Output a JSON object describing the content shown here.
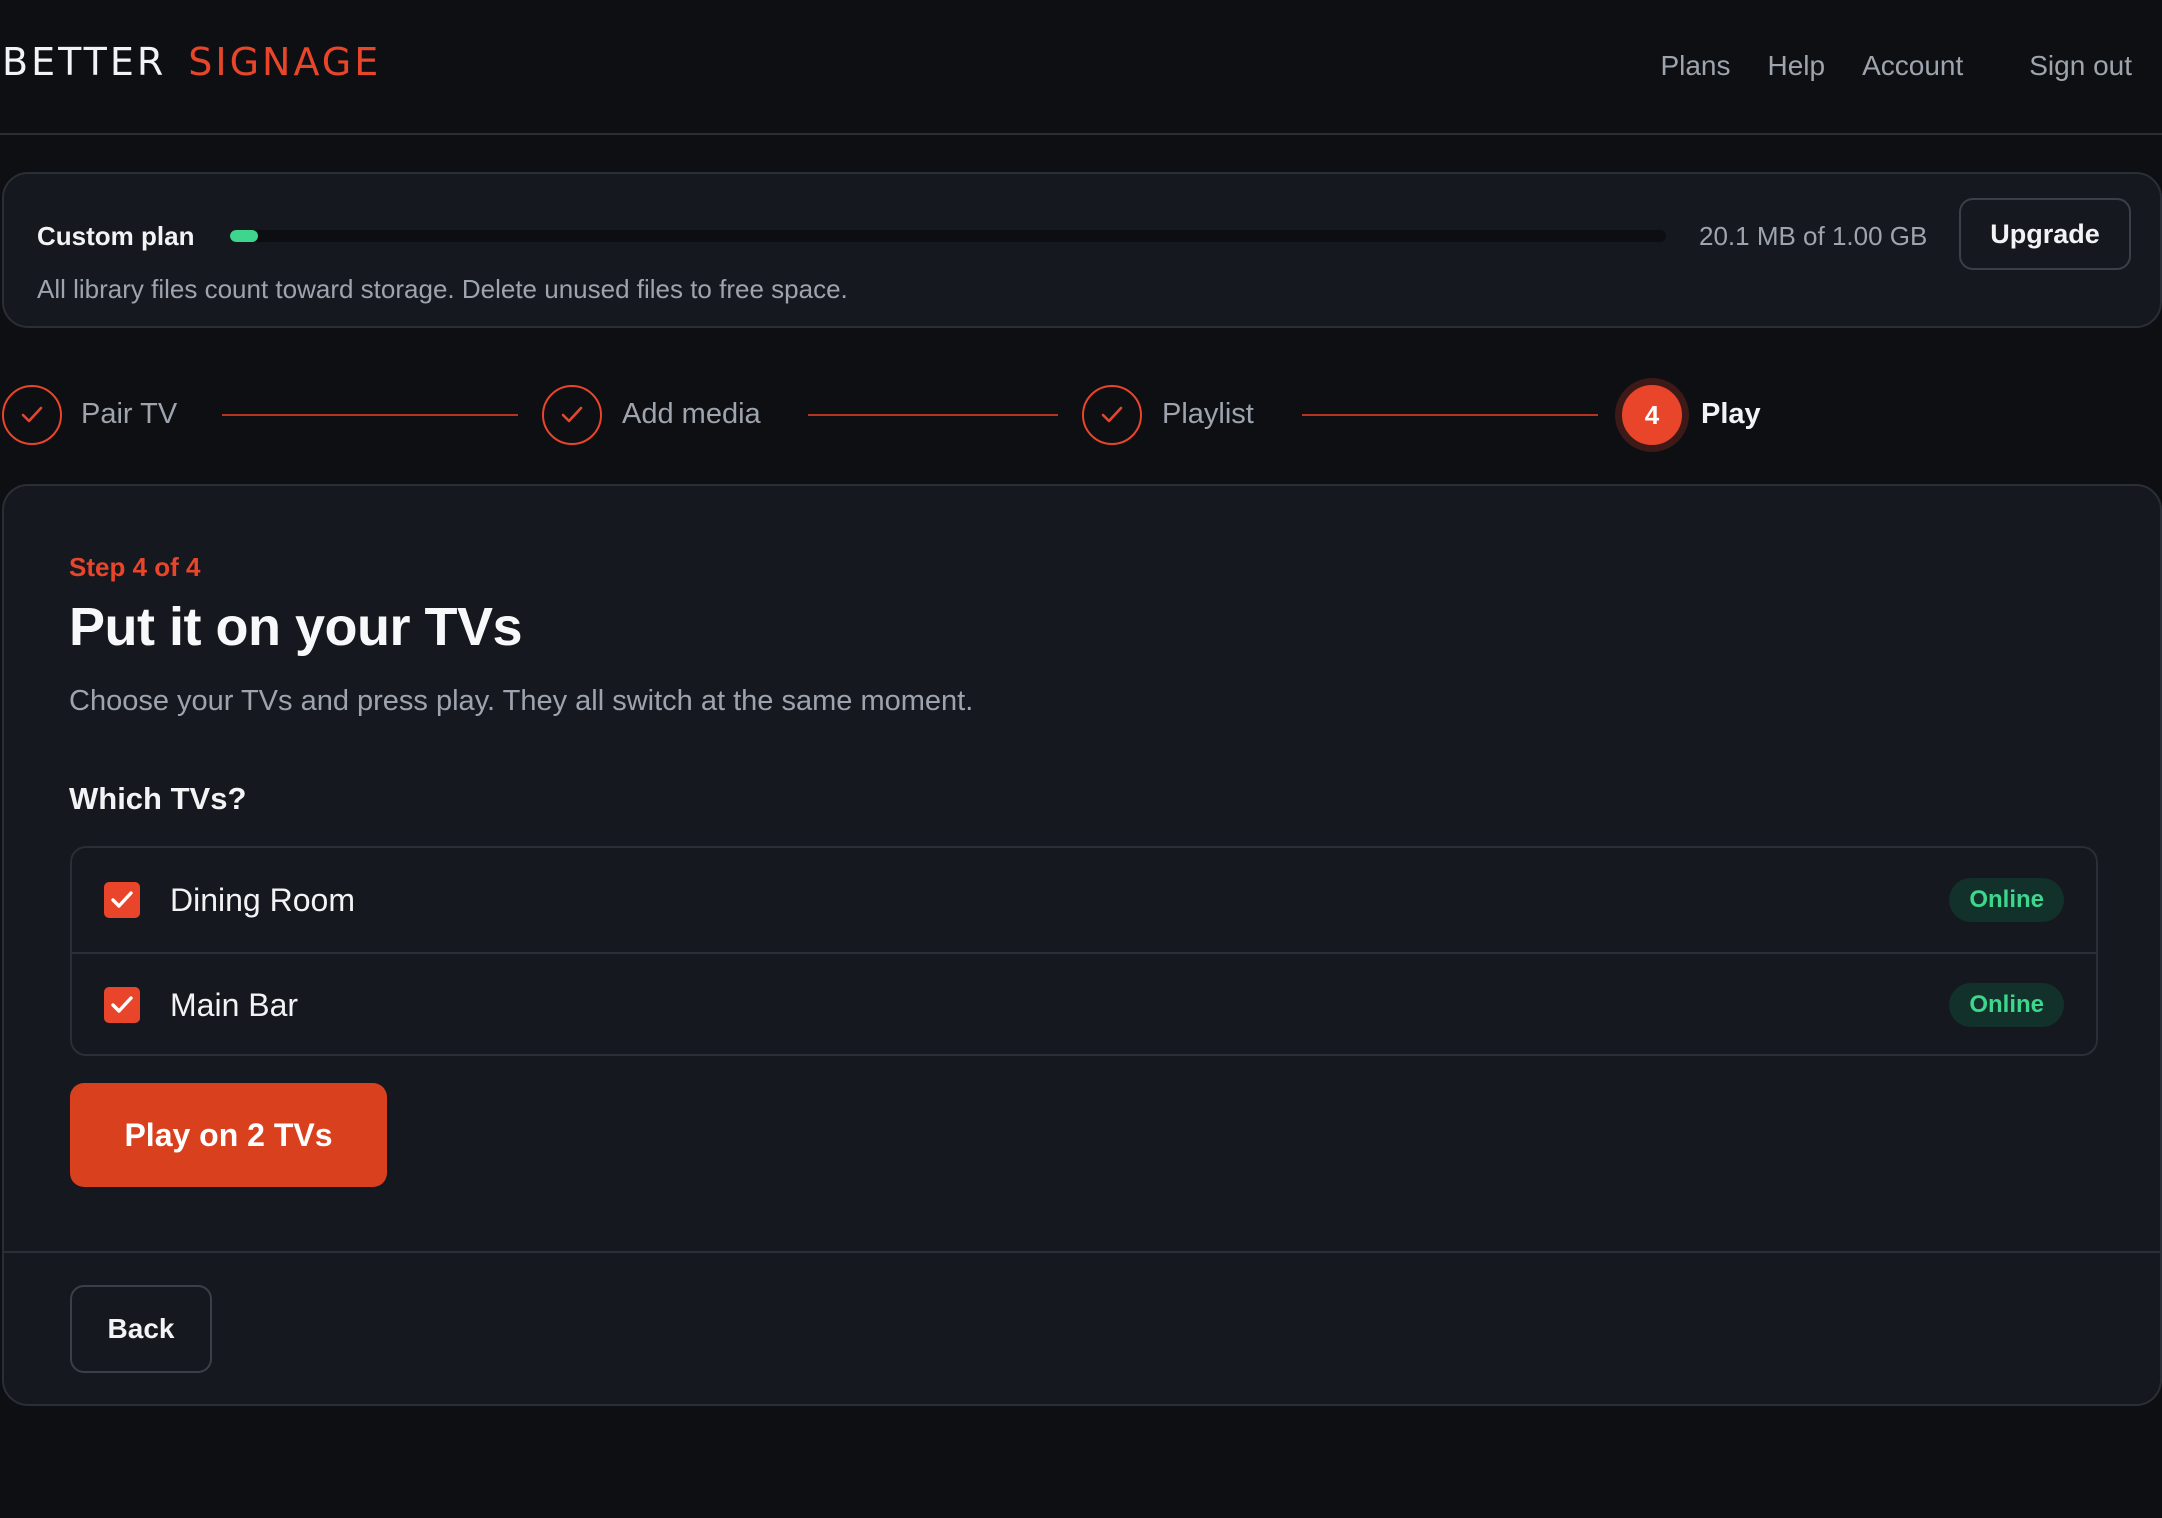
{
  "brand": {
    "word1": "BETTER",
    "word2": "SIGNAGE",
    "accent_color": "#e8452a"
  },
  "nav": {
    "plans": "Plans",
    "help": "Help",
    "account": "Account",
    "sign_out": "Sign out"
  },
  "storage": {
    "plan_name": "Custom plan",
    "usage_text": "20.1 MB of 1.00 GB",
    "used_fraction": 0.0196,
    "bar_color": "#3dd68c",
    "upgrade_label": "Upgrade",
    "note": "All library files count toward storage. Delete unused files to free space."
  },
  "stepper": {
    "steps": [
      {
        "label": "Pair TV",
        "state": "complete",
        "icon": "check-icon"
      },
      {
        "label": "Add media",
        "state": "complete",
        "icon": "check-icon"
      },
      {
        "label": "Playlist",
        "state": "complete",
        "icon": "check-icon"
      },
      {
        "label": "Play",
        "state": "active",
        "number": "4"
      }
    ]
  },
  "main": {
    "kicker": "Step 4 of 4",
    "title": "Put it on your TVs",
    "subtitle": "Choose your TVs and press play. They all switch at the same moment.",
    "which_label": "Which TVs?",
    "tvs": [
      {
        "name": "Dining Room",
        "checked": true,
        "status": "Online"
      },
      {
        "name": "Main Bar",
        "checked": true,
        "status": "Online"
      }
    ],
    "play_label": "Play on 2 TVs",
    "back_label": "Back"
  }
}
